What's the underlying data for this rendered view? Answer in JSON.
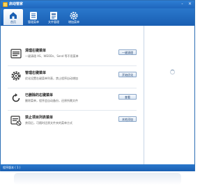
{
  "window": {
    "title": "启动管家",
    "controls": [
      "-",
      "×"
    ]
  },
  "toolbar": {
    "tabs": [
      {
        "label": "首页",
        "icon": "home-icon",
        "active": true
      },
      {
        "label": "管理菜单",
        "icon": "list-icon",
        "active": false
      },
      {
        "label": "文件管理",
        "icon": "document-icon",
        "active": false
      },
      {
        "label": "增加菜单",
        "icon": "gear-icon",
        "active": false
      }
    ]
  },
  "items": [
    {
      "title": "清理右键菜单",
      "desc": "一键清理 AS、WEODs、Send 等不用菜单",
      "button": "一键清理",
      "icon": "list-icon"
    },
    {
      "title": "管理右键菜单",
      "desc": "优化设置右键菜单列表，禁止程序自动增加",
      "button": "开始优化",
      "icon": "gear-icon"
    },
    {
      "title": "已删除的右键菜单",
      "desc": "删除菜单，程序会自动备份，还原所需文件",
      "button": "查看",
      "icon": "restore-icon"
    },
    {
      "title": "禁止项目列表菜单",
      "desc": "禁用后，可随时还原文件夹的菜单方式",
      "button": "本地添加",
      "icon": "disable-icon"
    }
  ],
  "status": {
    "text": "程序版本 ( 1 )"
  },
  "colors": {
    "accent": "#1f66bd",
    "button_border": "#8aa6c8"
  }
}
